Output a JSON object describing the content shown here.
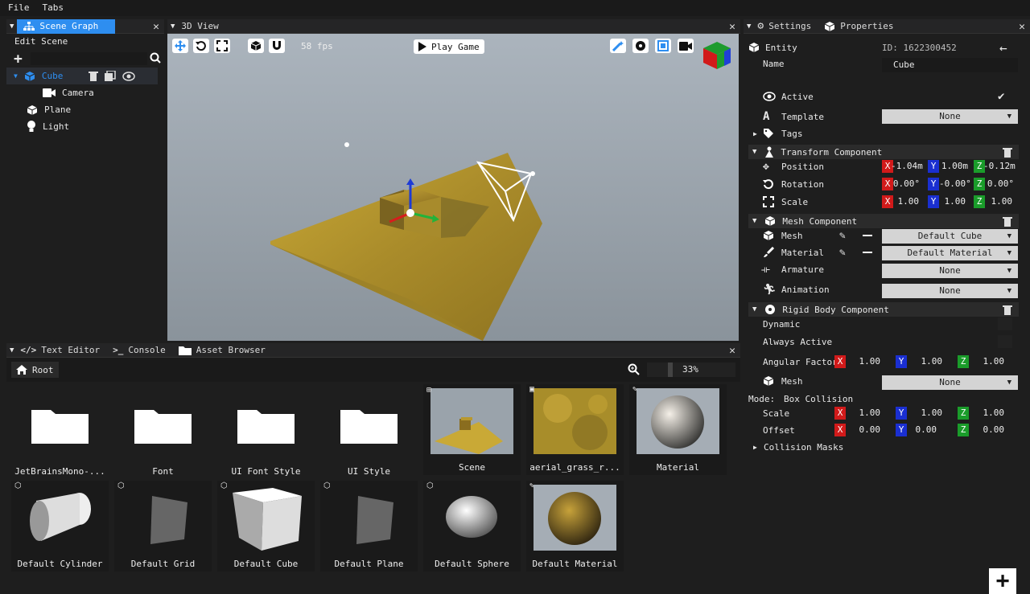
{
  "menubar": {
    "items": [
      "File",
      "Tabs"
    ]
  },
  "scene_graph": {
    "tab_label": "Scene Graph",
    "edit_label": "Edit Scene",
    "nodes": [
      {
        "label": "Cube",
        "icon": "cube-icon",
        "selected": true
      },
      {
        "label": "Camera",
        "icon": "camera-icon"
      },
      {
        "label": "Plane",
        "icon": "cube-icon"
      },
      {
        "label": "Light",
        "icon": "bulb-icon"
      }
    ]
  },
  "view3d": {
    "tab_label": "3D View",
    "fps": "58 fps",
    "play_label": "Play Game",
    "sky_top": "#a9b2bb",
    "sky_bottom": "#8b949c",
    "ground_color": "#b89a2a"
  },
  "settings_tab": "Settings",
  "properties": {
    "tab_label": "Properties",
    "entity_label": "Entity",
    "id_text": "ID: 1622300452",
    "name_label": "Name",
    "name_value": "Cube",
    "active_label": "Active",
    "template_label": "Template",
    "template_value": "None",
    "tags_label": "Tags",
    "transform": {
      "title": "Transform Component",
      "position_label": "Position",
      "position": [
        "-1.04m",
        "1.00m",
        "-0.12m"
      ],
      "rotation_label": "Rotation",
      "rotation": [
        "0.00°",
        "-0.00°",
        "0.00°"
      ],
      "scale_label": "Scale",
      "scale": [
        "1.00",
        "1.00",
        "1.00"
      ]
    },
    "mesh_component": {
      "title": "Mesh Component",
      "mesh_label": "Mesh",
      "mesh_value": "Default Cube",
      "material_label": "Material",
      "material_value": "Default Material",
      "armature_label": "Armature",
      "armature_value": "None",
      "animation_label": "Animation",
      "animation_value": "None"
    },
    "rigid_body": {
      "title": "Rigid Body Component",
      "dynamic_label": "Dynamic",
      "always_active_label": "Always Active",
      "angular_label": "Angular Factor",
      "angular": [
        "1.00",
        "1.00",
        "1.00"
      ],
      "mesh_label": "Mesh",
      "mesh_value": "None",
      "mode_label": "Mode:",
      "mode_value": "Box Collision",
      "scale_label": "Scale",
      "scale": [
        "1.00",
        "1.00",
        "1.00"
      ],
      "offset_label": "Offset",
      "offset": [
        "0.00",
        "0.00",
        "0.00"
      ],
      "collision_label": "Collision Masks"
    },
    "axis_labels": [
      "X",
      "Y",
      "Z"
    ]
  },
  "bottom": {
    "tabs": [
      "Text Editor",
      "Console",
      "Asset Browser"
    ],
    "root_label": "Root",
    "zoom": "33%",
    "assets_row1": [
      {
        "label": "JetBrainsMono-...",
        "kind": "folder"
      },
      {
        "label": "Font",
        "kind": "folder"
      },
      {
        "label": "UI Font Style",
        "kind": "folder"
      },
      {
        "label": "UI Style",
        "kind": "folder"
      },
      {
        "label": "Scene",
        "kind": "scene"
      },
      {
        "label": "aerial_grass_r...",
        "kind": "texture"
      },
      {
        "label": "Material",
        "kind": "material"
      }
    ],
    "assets_row2": [
      {
        "label": "Default Cylinder",
        "kind": "cylinder"
      },
      {
        "label": "Default Grid",
        "kind": "grid"
      },
      {
        "label": "Default Cube",
        "kind": "cube"
      },
      {
        "label": "Default Plane",
        "kind": "plane"
      },
      {
        "label": "Default Sphere",
        "kind": "sphere"
      },
      {
        "label": "Default Material",
        "kind": "material-gold"
      }
    ]
  },
  "accent": "#2e8ef0"
}
